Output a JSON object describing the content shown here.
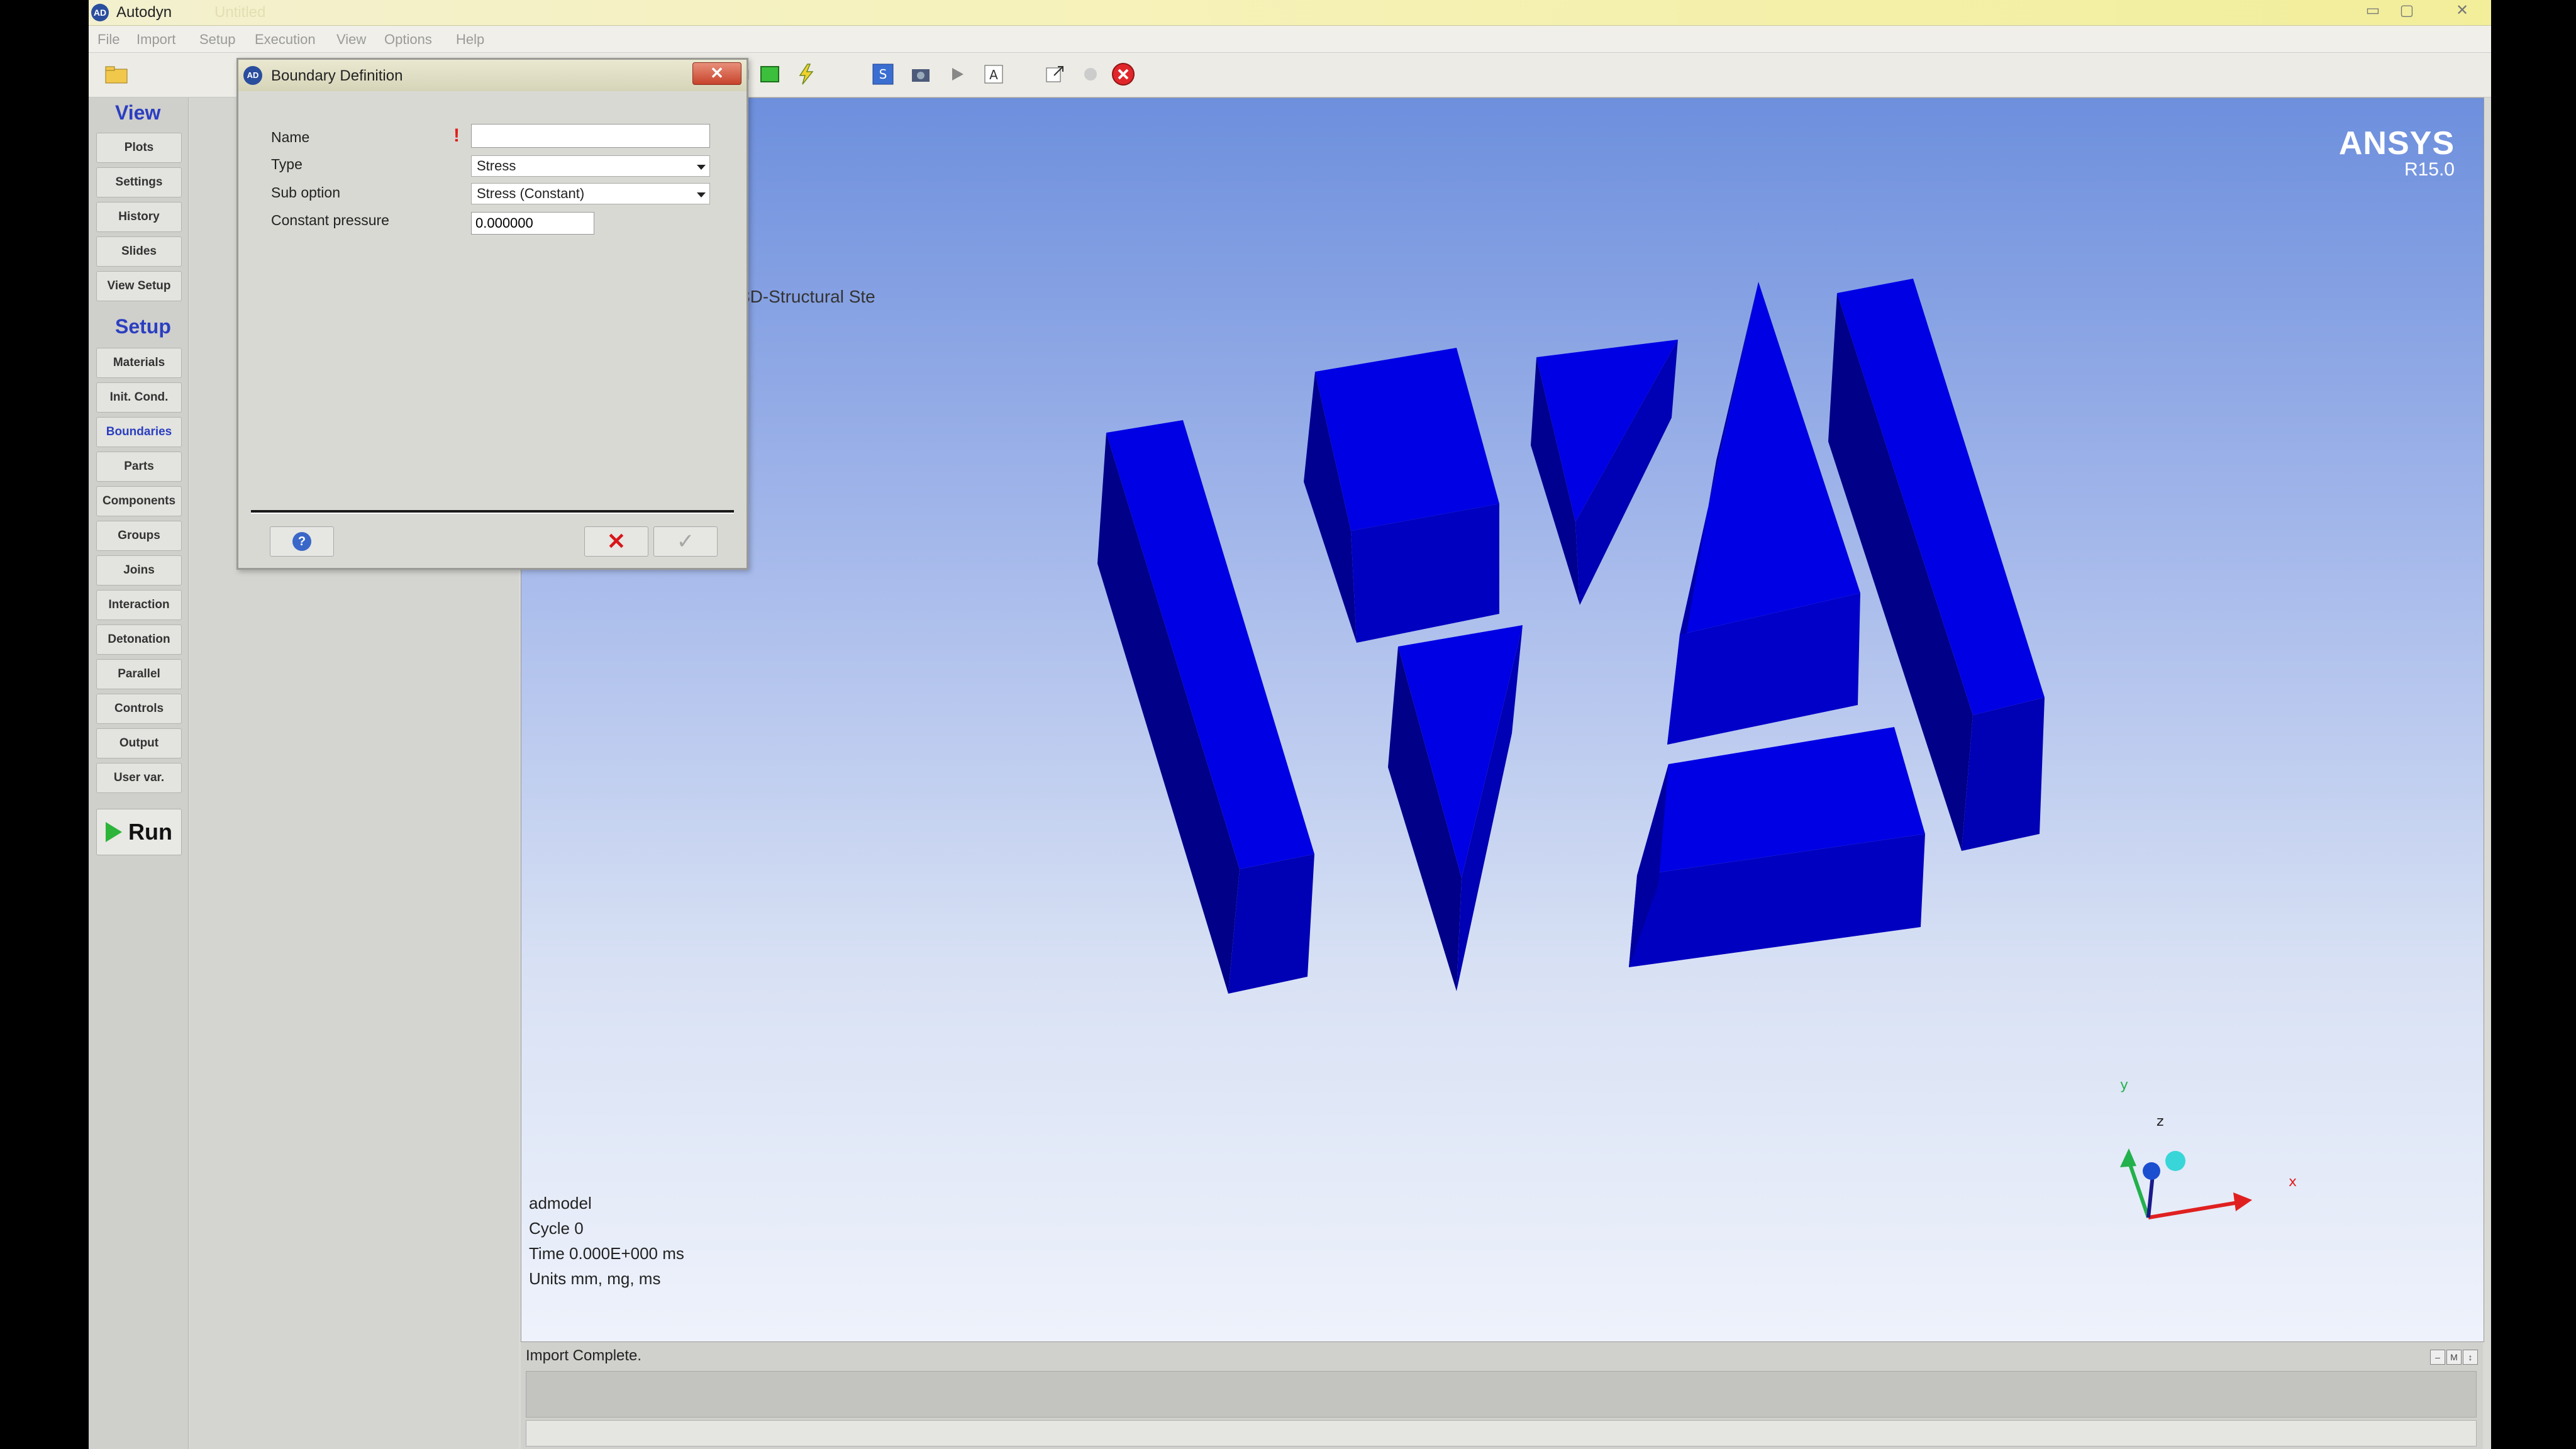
{
  "window": {
    "title": "Autodyn",
    "title_faded": "Untitled",
    "logo_text": "AD",
    "minimize_glyph": "▭",
    "restore_glyph": "▢",
    "close_glyph": "✕"
  },
  "menu": [
    "File",
    "Import",
    "Setup",
    "Execution",
    "View",
    "Options",
    "Help"
  ],
  "toolbar_icons": [
    "open-folder-icon",
    "save-icon",
    "print-icon",
    "undo-icon",
    "redo-icon",
    "chart-icon",
    "cube-icon",
    "green-box-icon",
    "lightning-icon",
    "refresh-icon",
    "camera-icon",
    "play-icon",
    "text-icon",
    "export-icon",
    "info-icon",
    "stop-icon"
  ],
  "nav": {
    "view_heading": "View",
    "setup_heading": "Setup",
    "view_buttons": [
      "Plots",
      "Settings",
      "History",
      "Slides",
      "View Setup"
    ],
    "setup_buttons": [
      "Materials",
      "Init. Cond.",
      "Boundaries",
      "Parts",
      "Components",
      "Groups",
      "Joins",
      "Interaction",
      "Detonation",
      "Parallel",
      "Controls",
      "Output",
      "User var."
    ],
    "run_label": "Run"
  },
  "viewport": {
    "brand": "ANSYS",
    "version": "R15.0",
    "behind_label": "3D-Structural Ste",
    "model_info": [
      "admodel",
      "Cycle 0",
      "Time 0.000E+000 ms",
      "Units mm, mg, ms"
    ],
    "axes": {
      "x": "x",
      "y": "y",
      "z": "z"
    },
    "shape_color": "#0000dd"
  },
  "dialog": {
    "title": "Boundary Definition",
    "icon_text": "AD",
    "name_label": "Name",
    "name_value": "",
    "required_mark": "!",
    "type_label": "Type",
    "type_value": "Stress",
    "sub_option_label": "Sub option",
    "sub_option_value": "Stress (Constant)",
    "pressure_label": "Constant pressure",
    "pressure_value": "0.000000",
    "close_glyph": "✕",
    "help_glyph": "?",
    "cancel_glyph": "✕",
    "ok_glyph": "✓"
  },
  "log": {
    "message": "Import Complete.",
    "ctrl_glyphs": [
      "‒",
      "M",
      "↕"
    ]
  }
}
